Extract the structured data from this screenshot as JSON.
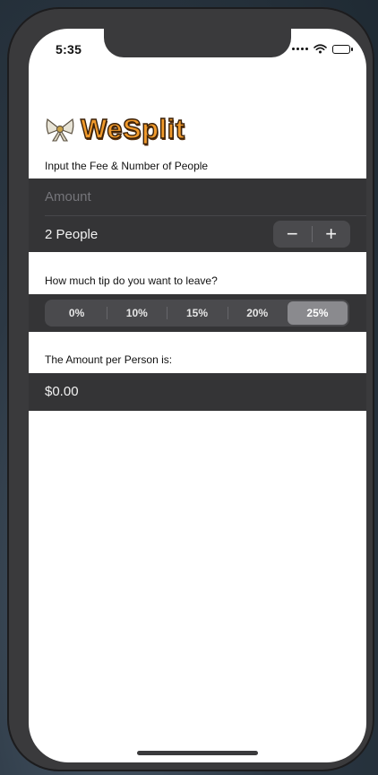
{
  "status_bar": {
    "time": "5:35"
  },
  "app": {
    "title": "WeSplit",
    "accent_color": "#f09a2c"
  },
  "input_section": {
    "label": "Input the Fee & Number of People",
    "amount_placeholder": "Amount",
    "people_value": "2 People",
    "decrement_symbol": "−",
    "increment_symbol": "+"
  },
  "tip_section": {
    "label": "How much tip do you want to leave?",
    "options": [
      "0%",
      "10%",
      "15%",
      "20%",
      "25%"
    ],
    "selected": "25%"
  },
  "result_section": {
    "label": "The Amount per Person is:",
    "value": "$0.00"
  }
}
